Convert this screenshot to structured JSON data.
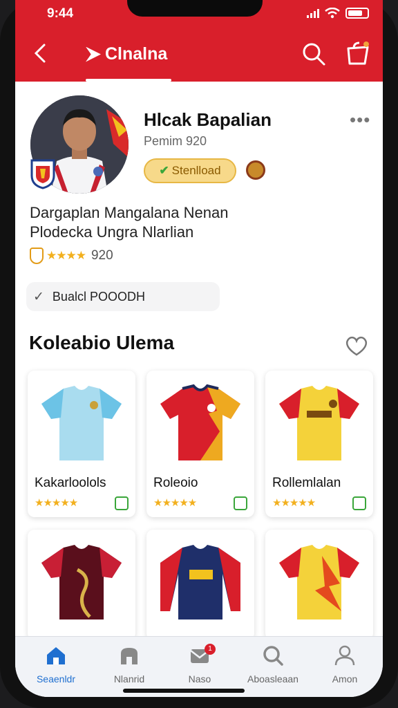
{
  "status_bar": {
    "time": "9:44"
  },
  "header": {
    "brand": "Clnalna",
    "back_icon": "chevron-left-icon",
    "search_icon": "search-icon",
    "cart_icon": "cart-icon"
  },
  "profile": {
    "name": "Hlcak Bapalian",
    "subtitle": "Pemim 920",
    "verified_label": "Stenlload",
    "bio_line1": "Dargaplan Mangalana Nenan",
    "bio_line2": "Plodecka Ungra Nlarlian",
    "rating_stars": "★★★★",
    "rating_value": "920",
    "follow_label": "Bualcl POOODH"
  },
  "collection": {
    "title": "Koleabio Ulema",
    "items": [
      {
        "title": "Kakarloolols",
        "stars": "★★★★★"
      },
      {
        "title": "Roleoio",
        "stars": "★★★★★"
      },
      {
        "title": "Rollemlalan",
        "stars": "★★★★★"
      },
      {
        "title": "",
        "stars": ""
      },
      {
        "title": "",
        "stars": ""
      },
      {
        "title": "",
        "stars": ""
      }
    ]
  },
  "bottom_nav": {
    "items": [
      {
        "label": "Seaenldr",
        "icon": "home-icon"
      },
      {
        "label": "Nlanrid",
        "icon": "store-icon"
      },
      {
        "label": "Naso",
        "icon": "mail-icon",
        "badge": "1"
      },
      {
        "label": "Aboasleaan",
        "icon": "search-icon"
      },
      {
        "label": "Amon",
        "icon": "user-icon"
      }
    ]
  },
  "colors": {
    "brand_red": "#d91f2b",
    "accent_blue": "#1f6fd0",
    "star_gold": "#f2b01e"
  }
}
